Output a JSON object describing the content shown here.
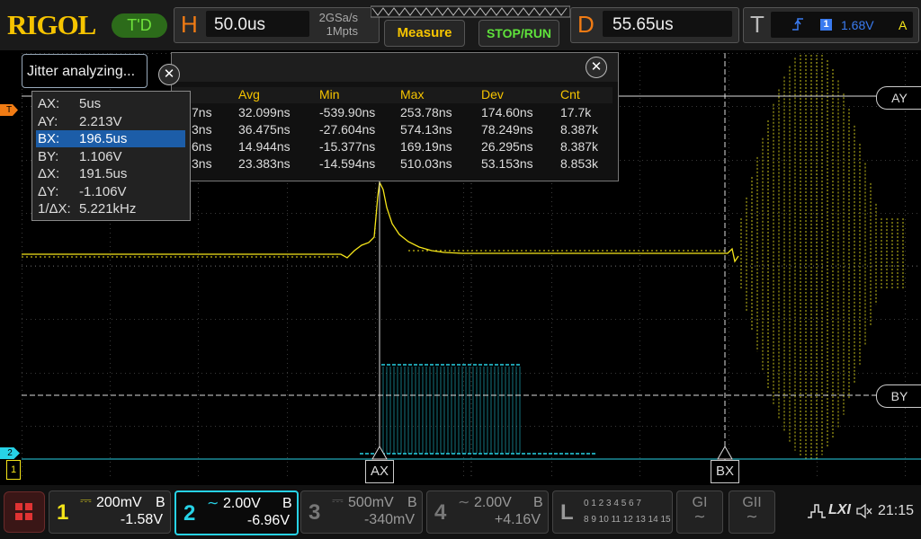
{
  "header": {
    "logo": "RIGOL",
    "trigger_mode": "T'D",
    "horizontal": {
      "letter": "H",
      "timebase": "50.0us",
      "sample_rate": "2GSa/s",
      "memory_depth": "1Mpts"
    },
    "measure_label": "Measure",
    "stop_run_label": "STOP/RUN",
    "delay": {
      "letter": "D",
      "value": "55.65us"
    },
    "trigger": {
      "letter": "T",
      "source_icon": "rising-edge-icon",
      "channel": "1",
      "level": "1.68V",
      "mode": "A"
    }
  },
  "jitter_panel": {
    "tab_label": "Jitter analyzing...",
    "columns": [
      "Avg",
      "Min",
      "Max",
      "Dev",
      "Cnt"
    ],
    "rows": [
      {
        "partial": "7ns",
        "avg": "32.099ns",
        "min": "-539.90ns",
        "max": "253.78ns",
        "dev": "174.60ns",
        "cnt": "17.7k"
      },
      {
        "partial": "3ns",
        "avg": "36.475ns",
        "min": "-27.604ns",
        "max": "574.13ns",
        "dev": "78.249ns",
        "cnt": "8.387k"
      },
      {
        "partial": "6ns",
        "avg": "14.944ns",
        "min": "-15.377ns",
        "max": "169.19ns",
        "dev": "26.295ns",
        "cnt": "8.387k"
      },
      {
        "partial": "3ns",
        "avg": "23.383ns",
        "min": "-14.594ns",
        "max": "510.03ns",
        "dev": "53.153ns",
        "cnt": "8.853k"
      }
    ]
  },
  "cursor_panel": {
    "rows": [
      {
        "label": "AX:",
        "value": "5us"
      },
      {
        "label": "AY:",
        "value": "2.213V"
      },
      {
        "label": "BX:",
        "value": "196.5us"
      },
      {
        "label": "BY:",
        "value": "1.106V"
      },
      {
        "label": "ΔX:",
        "value": "191.5us"
      },
      {
        "label": "ΔY:",
        "value": "-1.106V"
      },
      {
        "label": "1/ΔX:",
        "value": "5.221kHz"
      }
    ],
    "selected": "BX:"
  },
  "markers": {
    "ay": "AY",
    "by": "BY",
    "ax": "AX",
    "bx": "BX",
    "ch1": "1",
    "ch2": "2",
    "trig": "T"
  },
  "channels": [
    {
      "num": "1",
      "coupling": "DC",
      "scale": "200mV",
      "bw": "B",
      "offset": "-1.58V",
      "color": "#f6e619",
      "active": false
    },
    {
      "num": "2",
      "coupling": "AC",
      "scale": "2.00V",
      "bw": "B",
      "offset": "-6.96V",
      "color": "#27d2e6",
      "active": true
    },
    {
      "num": "3",
      "coupling": "DC",
      "scale": "500mV",
      "bw": "B",
      "offset": "-340mV",
      "color": "#777777",
      "active": false
    },
    {
      "num": "4",
      "coupling": "AC",
      "scale": "2.00V",
      "bw": "B",
      "offset": "+4.16V",
      "color": "#777777",
      "active": false
    }
  ],
  "logic": {
    "letter": "L",
    "row1": "0 1 2 3   4 5 6 7",
    "row2": "8 9 10 11 12 13 14 15"
  },
  "gen1_label": "GI",
  "gen2_label": "GII",
  "status": {
    "lxi": "LXI",
    "time": "21:15"
  },
  "colors": {
    "ch1": "#f6e619",
    "ch2": "#27d2e6",
    "accent": "#f07b14",
    "run": "#5fe23b"
  }
}
